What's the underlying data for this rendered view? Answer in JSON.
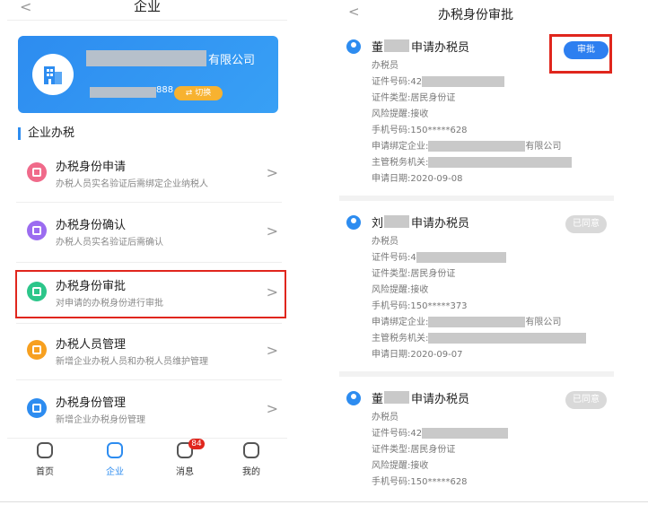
{
  "left": {
    "nav_title": "企业",
    "back_glyph": "<",
    "company": {
      "name_suffix": "有限公司",
      "id_suffix": "888",
      "switch_label": "⇄ 切换",
      "avatar_icon": "building-icon"
    },
    "section_title": "企业办税",
    "menu": [
      {
        "title": "办税身份申请",
        "subtitle": "办税人员实名验证后需绑定企业纳税人",
        "color": "#f06a8a",
        "icon": "id-card-icon"
      },
      {
        "title": "办税身份确认",
        "subtitle": "办税人员实名验证后需确认",
        "color": "#9b6cf0",
        "icon": "clipboard-icon"
      },
      {
        "title": "办税身份审批",
        "subtitle": "对申请的办税身份进行审批",
        "color": "#2cc68a",
        "icon": "approval-card-icon"
      },
      {
        "title": "办税人员管理",
        "subtitle": "新增企业办税人员和办税人员维护管理",
        "color": "#f7a020",
        "icon": "people-icon"
      },
      {
        "title": "办税身份管理",
        "subtitle": "新增企业办税身份管理",
        "color": "#2d8cf0",
        "icon": "person-icon"
      }
    ],
    "arrow_glyph": ">",
    "tabs": [
      {
        "label": "首页",
        "icon": "home-icon",
        "active": false
      },
      {
        "label": "企业",
        "icon": "enterprise-icon",
        "active": true
      },
      {
        "label": "消息",
        "icon": "message-icon",
        "active": false,
        "badge": "84"
      },
      {
        "label": "我的",
        "icon": "profile-icon",
        "active": false
      }
    ]
  },
  "right": {
    "nav_title": "办税身份审批",
    "back_glyph": "<",
    "cards": [
      {
        "surname": "董",
        "action": "申请办税员",
        "role": "办税员",
        "id_label": "证件号码:",
        "id_prefix": "42",
        "id_type_label": "证件类型:",
        "id_type": "居民身份证",
        "risk_label": "风险提醒:",
        "risk": "接收",
        "phone_label": "手机号码:",
        "phone": "150*****628",
        "bind_label": "申请绑定企业:",
        "bind_suffix": "有限公司",
        "authority_label": "主管税务机关:",
        "date_label": "申请日期:",
        "date": "2020-09-08",
        "button": "审批"
      },
      {
        "surname": "刘",
        "action": "申请办税员",
        "role": "办税员",
        "id_label": "证件号码:",
        "id_prefix": "4",
        "id_type_label": "证件类型:",
        "id_type": "居民身份证",
        "risk_label": "风险提醒:",
        "risk": "接收",
        "phone_label": "手机号码:",
        "phone": "150*****373",
        "bind_label": "申请绑定企业:",
        "bind_suffix": "有限公司",
        "authority_label": "主管税务机关:",
        "date_label": "申请日期:",
        "date": "2020-09-07",
        "button": "已同意"
      },
      {
        "surname": "董",
        "action": "申请办税员",
        "role": "办税员",
        "id_label": "证件号码:",
        "id_prefix": "42",
        "id_type_label": "证件类型:",
        "id_type": "居民身份证",
        "risk_label": "风险提醒:",
        "risk": "接收",
        "phone_label": "手机号码:",
        "phone": "150*****628",
        "button": "已同意"
      }
    ]
  }
}
